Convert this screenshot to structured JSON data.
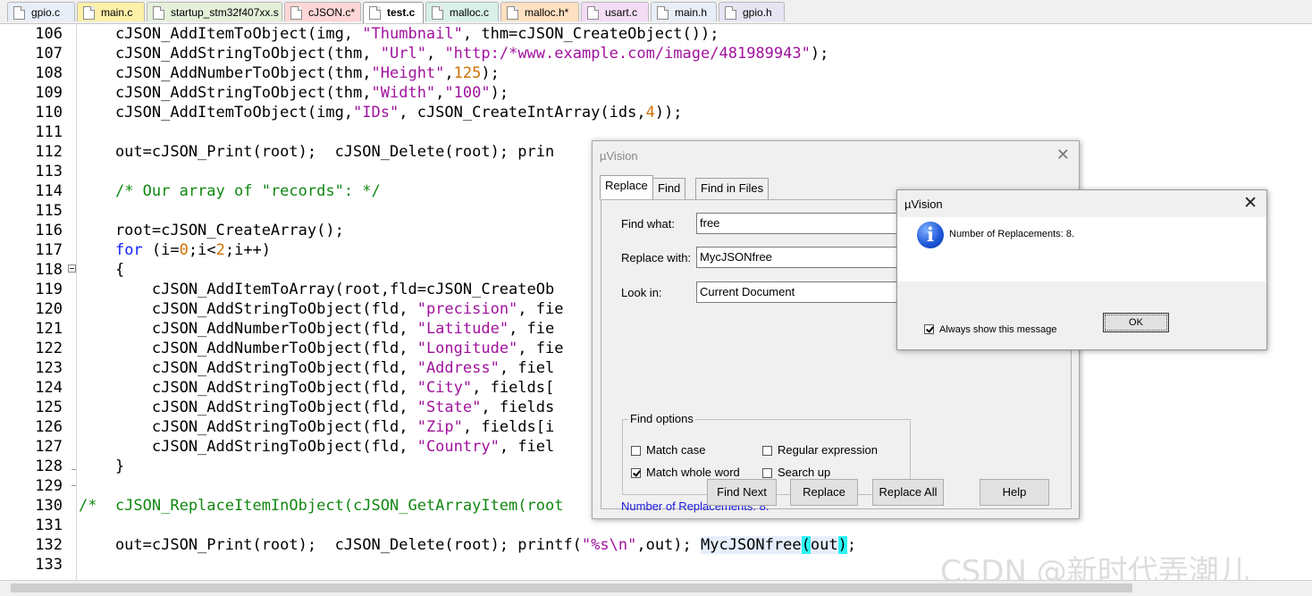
{
  "tabs": [
    {
      "label": "gpio.c",
      "color": "#e8eef8"
    },
    {
      "label": "main.c",
      "color": "#fff0a8"
    },
    {
      "label": "startup_stm32f407xx.s",
      "color": "#e4f0d8"
    },
    {
      "label": "cJSON.c*",
      "color": "#ffd6d6"
    },
    {
      "label": "test.c",
      "color": "#ffffff"
    },
    {
      "label": "malloc.c",
      "color": "#d8f0e8"
    },
    {
      "label": "malloc.h*",
      "color": "#ffe0c0"
    },
    {
      "label": "usart.c",
      "color": "#f4dcf4"
    },
    {
      "label": "main.h",
      "color": "#e8eef8"
    },
    {
      "label": "gpio.h",
      "color": "#e8e4f4"
    }
  ],
  "editor": {
    "line_numbers": [
      "106",
      "107",
      "108",
      "109",
      "110",
      "111",
      "112",
      "113",
      "114",
      "115",
      "116",
      "117",
      "118",
      "119",
      "120",
      "121",
      "122",
      "123",
      "124",
      "125",
      "126",
      "127",
      "128",
      "129",
      "130",
      "131",
      "132",
      "133"
    ],
    "code": {
      "l106": {
        "a": "    cJSON_AddItemToObject(img, ",
        "s1": "\"Thumbnail\"",
        "b": ", thm=cJSON_CreateObject());"
      },
      "l107": {
        "a": "    cJSON_AddStringToObject(thm, ",
        "s1": "\"Url\"",
        "b": ", ",
        "s2": "\"http:/*www.example.com/image/481989943\"",
        "c": ");"
      },
      "l108": {
        "a": "    cJSON_AddNumberToObject(thm,",
        "s1": "\"Height\"",
        "b": ",",
        "n1": "125",
        "c": ");"
      },
      "l109": {
        "a": "    cJSON_AddStringToObject(thm,",
        "s1": "\"Width\"",
        "b": ",",
        "s2": "\"100\"",
        "c": ");"
      },
      "l110": {
        "a": "    cJSON_AddItemToObject(img,",
        "s1": "\"IDs\"",
        "b": ", cJSON_CreateIntArray(ids,",
        "n1": "4",
        "c": "));"
      },
      "l112": {
        "a": "    out=cJSON_Print(root);  cJSON_Delete(root); prin"
      },
      "l114": {
        "a": "    ",
        "cm": "/* Our array of \"records\": */"
      },
      "l116": {
        "a": "    root=cJSON_CreateArray();"
      },
      "l117": {
        "a": "    ",
        "kw": "for",
        "b": " (i=",
        "n1": "0",
        "c": ";i<",
        "n2": "2",
        "d": ";i++)"
      },
      "l118": {
        "a": "    {"
      },
      "l119": {
        "a": "        cJSON_AddItemToArray(root,fld=cJSON_CreateOb"
      },
      "l120": {
        "a": "        cJSON_AddStringToObject(fld, ",
        "s1": "\"precision\"",
        "b": ", fie"
      },
      "l121": {
        "a": "        cJSON_AddNumberToObject(fld, ",
        "s1": "\"Latitude\"",
        "b": ", fie"
      },
      "l122": {
        "a": "        cJSON_AddNumberToObject(fld, ",
        "s1": "\"Longitude\"",
        "b": ", fie"
      },
      "l123": {
        "a": "        cJSON_AddStringToObject(fld, ",
        "s1": "\"Address\"",
        "b": ", fiel"
      },
      "l124": {
        "a": "        cJSON_AddStringToObject(fld, ",
        "s1": "\"City\"",
        "b": ", fields["
      },
      "l125": {
        "a": "        cJSON_AddStringToObject(fld, ",
        "s1": "\"State\"",
        "b": ", fields"
      },
      "l126": {
        "a": "        cJSON_AddStringToObject(fld, ",
        "s1": "\"Zip\"",
        "b": ", fields[i"
      },
      "l127": {
        "a": "        cJSON_AddStringToObject(fld, ",
        "s1": "\"Country\"",
        "b": ", fiel"
      },
      "l128": {
        "a": "    }"
      },
      "l130": {
        "cm": "/*  cJSON_ReplaceItemInObject(cJSON_GetArrayItem(root"
      },
      "l132": {
        "a": "    out=cJSON_Print(root);  cJSON_Delete(root); printf(",
        "s1": "\"%s\\n\"",
        "b": ",out); ",
        "h1": "MycJSONfree",
        "p1": "(",
        "h2": "out",
        "p2": ")",
        "c": ";"
      }
    }
  },
  "replace_dialog": {
    "title": "µVision",
    "close": "✕",
    "tabs": [
      "Replace",
      "Find",
      "Find in Files"
    ],
    "find_what_label": "Find what:",
    "find_what_value": "free",
    "replace_with_label": "Replace with:",
    "replace_with_value": "MycJSONfree",
    "look_in_label": "Look in:",
    "look_in_value": "Current Document",
    "options_label": "Find options",
    "options": {
      "match_case": {
        "label": "Match case",
        "checked": false
      },
      "match_whole_word": {
        "label": "Match whole word",
        "checked": true
      },
      "regular_expression": {
        "label": "Regular expression",
        "checked": false
      },
      "search_up": {
        "label": "Search up",
        "checked": false
      }
    },
    "status": "Number of Replacements: 8.",
    "buttons": {
      "find_next": "Find Next",
      "replace": "Replace",
      "replace_all": "Replace All",
      "help": "Help"
    }
  },
  "message_box": {
    "title": "µVision",
    "close": "✕",
    "icon": "info-icon",
    "icon_glyph": "i",
    "text": "Number of Replacements: 8.",
    "always_show_label": "Always show this message",
    "always_show_checked": true,
    "ok_label": "OK"
  },
  "watermark": "CSDN @新时代弄潮儿"
}
